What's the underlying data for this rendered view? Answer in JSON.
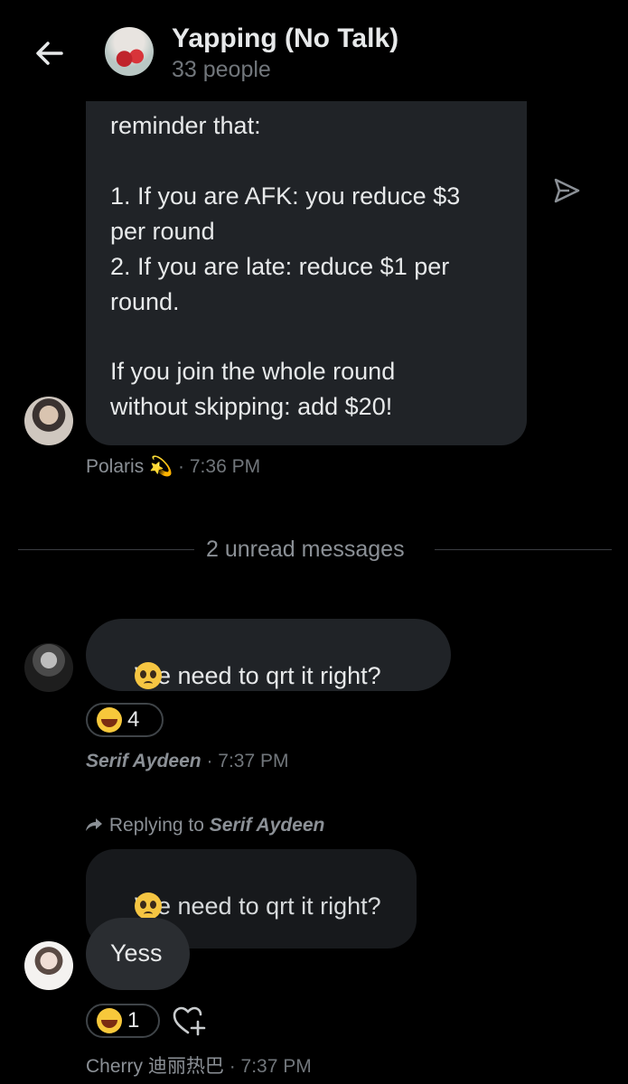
{
  "header": {
    "title": "Yapping (No Talk)",
    "subtitle": "33 people"
  },
  "messages": {
    "polaris": {
      "lines": [
        "reminder that:",
        "1. If you are AFK: you reduce $3",
        "per round",
        "2. If you are late: reduce $1 per",
        "round.",
        "If you join the whole round",
        "without skipping: add $20!"
      ],
      "author": "Polaris",
      "author_emoji": "💫",
      "time": "· 7:36 PM"
    },
    "divider": "2 unread messages",
    "serif": {
      "text": "We need to qrt it right?",
      "reaction_count": "4",
      "author": "Serif Aydeen",
      "time": "· 7:37 PM"
    },
    "cherry": {
      "reply_prefix": "Replying to",
      "reply_name": "Serif Aydeen",
      "quoted_text": "We need to qrt it right?",
      "text": "Yess",
      "reaction_count": "1",
      "author": "Cherry 迪丽热巴",
      "time": "· 7:37 PM"
    }
  },
  "colors": {
    "background": "#000000",
    "bubble": "#202327",
    "muted_text": "#71767b"
  }
}
